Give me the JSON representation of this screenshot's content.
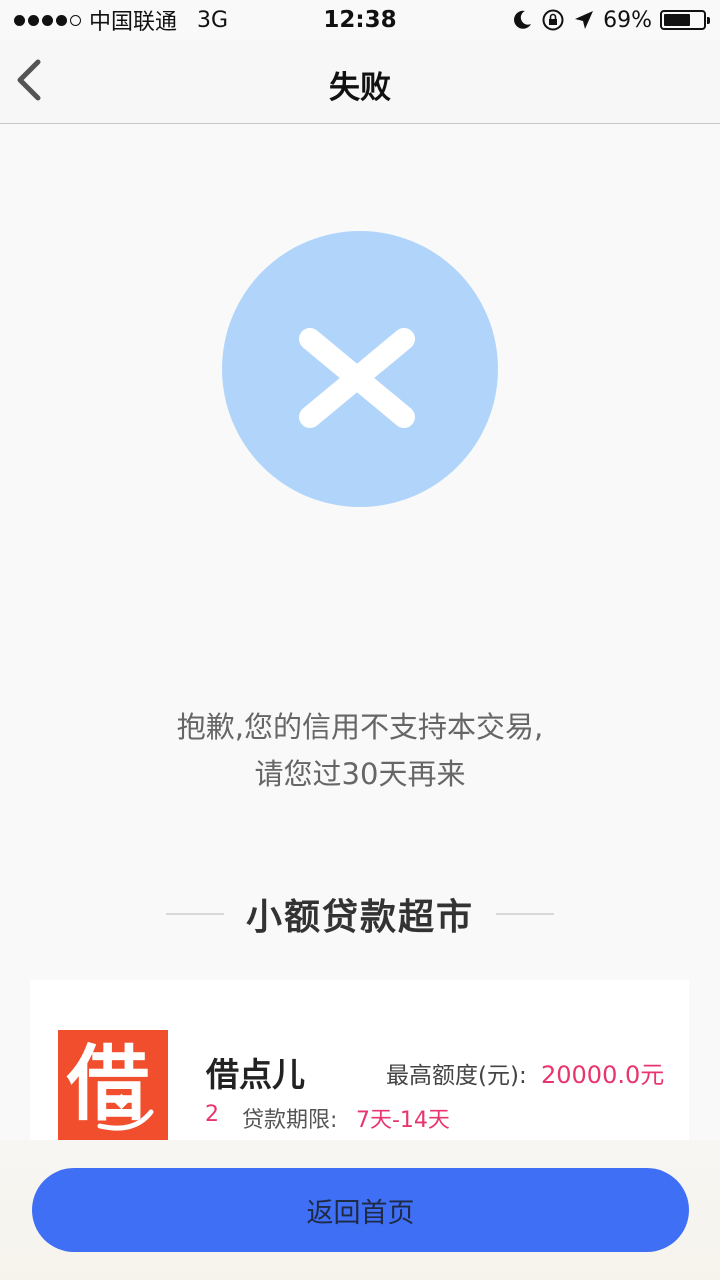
{
  "status_bar": {
    "carrier": "中国联通",
    "network": "3G",
    "time": "12:38",
    "battery": "69%",
    "battery_level": 0.69
  },
  "nav": {
    "title": "失败"
  },
  "result": {
    "line1": "抱歉,您的信用不支持本交易,",
    "line2": "请您过30天再来"
  },
  "market": {
    "title": "小额贷款超市",
    "items": [
      {
        "logo_char": "借",
        "name": "借点儿",
        "quota_label": "最高额度(元):",
        "quota_value": "20000.0元",
        "rank": "2",
        "period_label": "贷款期限:",
        "period_value": "7天-14天"
      }
    ]
  },
  "footer": {
    "home_label": "返回首页"
  },
  "colors": {
    "accent": "#3f6ff5",
    "fail_circle": "#b1d5fa",
    "highlight": "#e8356d",
    "logo_bg": "#f04e2c"
  }
}
